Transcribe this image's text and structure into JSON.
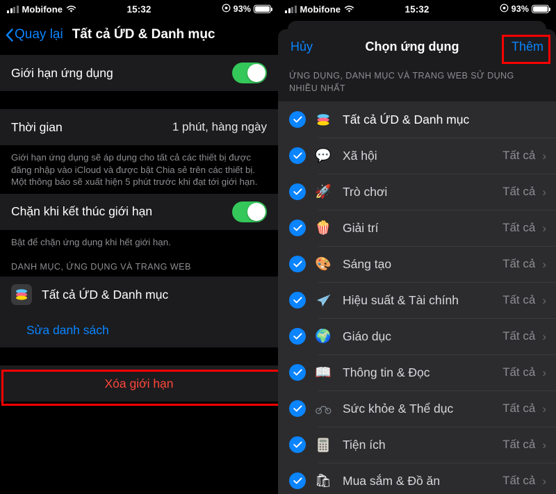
{
  "status_bar": {
    "carrier": "Mobifone",
    "time": "15:32",
    "battery_percent": "93%",
    "signal_icon": "signal-bars-icon",
    "wifi_icon": "wifi-icon",
    "focus_icon": "focus-mode-icon",
    "battery_icon": "battery-icon"
  },
  "left": {
    "nav": {
      "back_label": "Quay lại",
      "title": "Tất cả ỨD & Danh mục"
    },
    "app_limit_row": {
      "label": "Giới hạn ứng dụng",
      "toggle_on": true
    },
    "time_row": {
      "label": "Thời gian",
      "value": "1 phút, hàng ngày"
    },
    "limit_footnote": "Giới hạn ứng dụng sẽ áp dụng cho tất cả các thiết bị được đăng nhập vào iCloud và được bật Chia sẻ trên các thiết bị. Một thông báo sẽ xuất hiện 5 phút trước khi đạt tới giới hạn.",
    "block_row": {
      "label": "Chặn khi kết thúc giới hạn",
      "toggle_on": true
    },
    "block_footnote": "Bật để chặn ứng dụng khi hết giới hạn.",
    "section_header": "DANH MỤC, ỨNG DỤNG VÀ TRANG WEB",
    "app_row": {
      "label": "Tất cả ỨD & Danh mục",
      "icon": "stacked-layers-icon"
    },
    "edit_list_label": "Sửa danh sách",
    "delete_limit_label": "Xóa giới hạn"
  },
  "right": {
    "sheet_nav": {
      "cancel_label": "Hủy",
      "title": "Chọn ứng dụng",
      "add_label": "Thêm"
    },
    "section_header": "ỨNG DỤNG, DANH MỤC VÀ TRANG WEB SỬ DỤNG NHIỀU NHẤT",
    "items": [
      {
        "checked": true,
        "icon": "stacked-layers-icon",
        "emoji": "📚",
        "label": "Tất cả ỨD & Danh mục",
        "value": "",
        "chevron": false
      },
      {
        "checked": true,
        "icon": "social-icon",
        "emoji": "💬",
        "label": "Xã hội",
        "value": "Tất cả",
        "chevron": true
      },
      {
        "checked": true,
        "icon": "rocket-icon",
        "emoji": "🚀",
        "label": "Trò chơi",
        "value": "Tất cả",
        "chevron": true
      },
      {
        "checked": true,
        "icon": "popcorn-icon",
        "emoji": "🍿",
        "label": "Giải trí",
        "value": "Tất cả",
        "chevron": true
      },
      {
        "checked": true,
        "icon": "palette-icon",
        "emoji": "🎨",
        "label": "Sáng tạo",
        "value": "Tất cả",
        "chevron": true
      },
      {
        "checked": true,
        "icon": "paper-plane-icon",
        "emoji": "🛩",
        "label": "Hiệu suất & Tài chính",
        "value": "Tất cả",
        "chevron": true
      },
      {
        "checked": true,
        "icon": "globe-icon",
        "emoji": "🌍",
        "label": "Giáo dục",
        "value": "Tất cả",
        "chevron": true
      },
      {
        "checked": true,
        "icon": "open-book-icon",
        "emoji": "📖",
        "label": "Thông tin & Đọc",
        "value": "Tất cả",
        "chevron": true
      },
      {
        "checked": true,
        "icon": "bicycle-icon",
        "emoji": "🚲",
        "label": "Sức khỏe & Thể dục",
        "value": "Tất cả",
        "chevron": true
      },
      {
        "checked": true,
        "icon": "calculator-icon",
        "emoji": "🧮",
        "label": "Tiện ích",
        "value": "Tất cả",
        "chevron": true
      },
      {
        "checked": true,
        "icon": "shopping-bag-icon",
        "emoji": "🛍",
        "label": "Mua sắm & Đồ ăn",
        "value": "Tất cả",
        "chevron": true
      }
    ]
  },
  "annotations": {
    "highlight_color": "#ff0000",
    "boxes": [
      "edit-list-highlight",
      "add-button-highlight"
    ]
  },
  "colors": {
    "accent_blue": "#0a84ff",
    "toggle_green": "#34c759",
    "destructive_red": "#ff453a",
    "card_bg": "#1c1c1e",
    "list_bg": "#2c2c2e"
  }
}
